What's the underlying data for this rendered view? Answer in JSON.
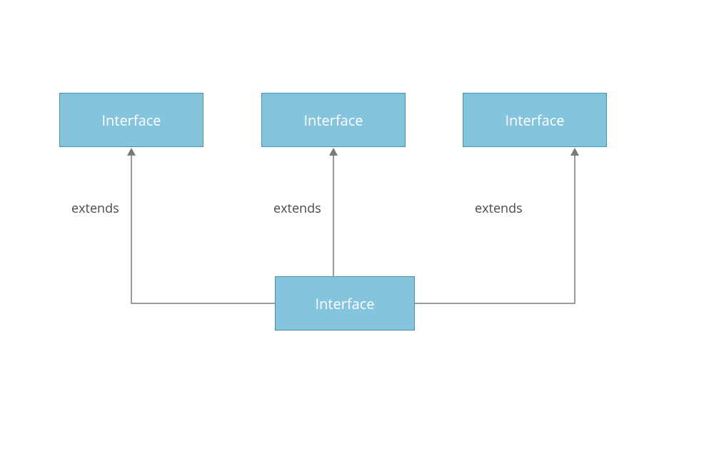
{
  "diagram": {
    "nodes": {
      "top_left": {
        "label": "Interface"
      },
      "top_center": {
        "label": "Interface"
      },
      "top_right": {
        "label": "Interface"
      },
      "bottom": {
        "label": "Interface"
      }
    },
    "edges": {
      "left": {
        "label": "extends"
      },
      "center": {
        "label": "extends"
      },
      "right": {
        "label": "extends"
      }
    },
    "colors": {
      "box_fill": "#85c4dd",
      "box_border": "#4a90a8",
      "box_text": "#ffffff",
      "line": "#7a7a7a",
      "label": "#4a4a4a"
    }
  }
}
